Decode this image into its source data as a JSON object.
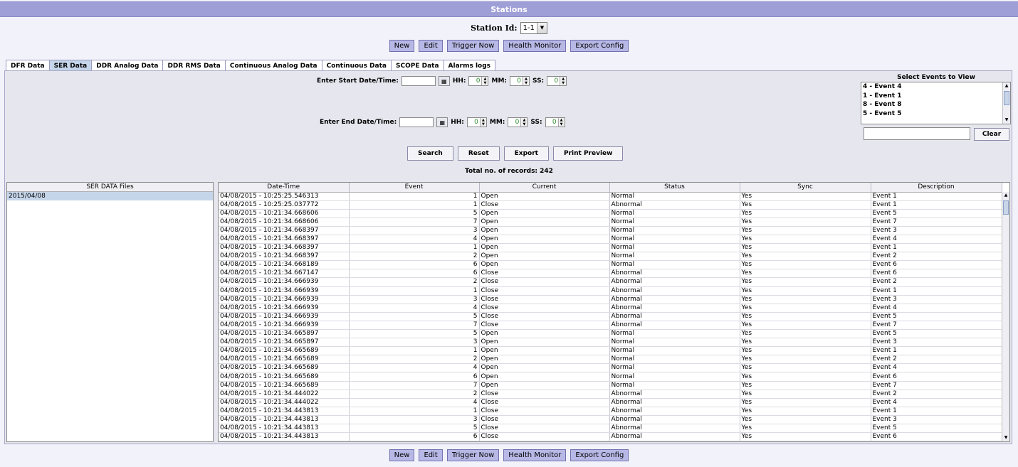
{
  "window": {
    "title": "Stations"
  },
  "station": {
    "label": "Station Id:",
    "value": "1-1"
  },
  "toolbar": {
    "buttons": [
      "New",
      "Edit",
      "Trigger Now",
      "Health Monitor",
      "Export Config"
    ]
  },
  "tabs": {
    "items": [
      "DFR Data",
      "SER Data",
      "DDR Analog Data",
      "DDR RMS Data",
      "Continuous Analog Data",
      "Continuous Data",
      "SCOPE Data",
      "Alarms logs"
    ],
    "active": "SER Data"
  },
  "filters": {
    "start_label": "Enter Start Date/Time:",
    "end_label": "Enter End Date/Time:",
    "hh_label": "HH:",
    "mm_label": "MM:",
    "ss_label": "SS:",
    "start": {
      "hh": "0",
      "mm": "0",
      "ss": "0"
    },
    "end": {
      "hh": "0",
      "mm": "0",
      "ss": "0"
    }
  },
  "actions": {
    "search": "Search",
    "reset": "Reset",
    "export": "Export",
    "print_preview": "Print Preview"
  },
  "total": "Total no. of records: 242",
  "events": {
    "title": "Select Events to View",
    "items": [
      "4 - Event 4",
      "1 - Event 1",
      "8 - Event 8",
      "5 - Event 5"
    ],
    "clear": "Clear"
  },
  "files": {
    "header": "SER DATA Files",
    "rows": [
      "2015/04/08"
    ]
  },
  "table": {
    "columns": [
      "Date-Time",
      "Event",
      "Current",
      "Status",
      "Sync",
      "Description"
    ],
    "rows": [
      [
        "04/08/2015 - 10:25:25.546313",
        "1",
        "Open",
        "Normal",
        "Yes",
        "Event 1"
      ],
      [
        "04/08/2015 - 10:25:25.037772",
        "1",
        "Close",
        "Abnormal",
        "Yes",
        "Event 1"
      ],
      [
        "04/08/2015 - 10:21:34.668606",
        "5",
        "Open",
        "Normal",
        "Yes",
        "Event 5"
      ],
      [
        "04/08/2015 - 10:21:34.668606",
        "7",
        "Open",
        "Normal",
        "Yes",
        "Event 7"
      ],
      [
        "04/08/2015 - 10:21:34.668397",
        "3",
        "Open",
        "Normal",
        "Yes",
        "Event 3"
      ],
      [
        "04/08/2015 - 10:21:34.668397",
        "4",
        "Open",
        "Normal",
        "Yes",
        "Event 4"
      ],
      [
        "04/08/2015 - 10:21:34.668397",
        "1",
        "Open",
        "Normal",
        "Yes",
        "Event 1"
      ],
      [
        "04/08/2015 - 10:21:34.668397",
        "2",
        "Open",
        "Normal",
        "Yes",
        "Event 2"
      ],
      [
        "04/08/2015 - 10:21:34.668189",
        "6",
        "Open",
        "Normal",
        "Yes",
        "Event 6"
      ],
      [
        "04/08/2015 - 10:21:34.667147",
        "6",
        "Close",
        "Abnormal",
        "Yes",
        "Event 6"
      ],
      [
        "04/08/2015 - 10:21:34.666939",
        "2",
        "Close",
        "Abnormal",
        "Yes",
        "Event 2"
      ],
      [
        "04/08/2015 - 10:21:34.666939",
        "1",
        "Close",
        "Abnormal",
        "Yes",
        "Event 1"
      ],
      [
        "04/08/2015 - 10:21:34.666939",
        "3",
        "Close",
        "Abnormal",
        "Yes",
        "Event 3"
      ],
      [
        "04/08/2015 - 10:21:34.666939",
        "4",
        "Close",
        "Abnormal",
        "Yes",
        "Event 4"
      ],
      [
        "04/08/2015 - 10:21:34.666939",
        "5",
        "Close",
        "Abnormal",
        "Yes",
        "Event 5"
      ],
      [
        "04/08/2015 - 10:21:34.666939",
        "7",
        "Close",
        "Abnormal",
        "Yes",
        "Event 7"
      ],
      [
        "04/08/2015 - 10:21:34.665897",
        "5",
        "Open",
        "Normal",
        "Yes",
        "Event 5"
      ],
      [
        "04/08/2015 - 10:21:34.665897",
        "3",
        "Open",
        "Normal",
        "Yes",
        "Event 3"
      ],
      [
        "04/08/2015 - 10:21:34.665689",
        "1",
        "Open",
        "Normal",
        "Yes",
        "Event 1"
      ],
      [
        "04/08/2015 - 10:21:34.665689",
        "2",
        "Open",
        "Normal",
        "Yes",
        "Event 2"
      ],
      [
        "04/08/2015 - 10:21:34.665689",
        "4",
        "Open",
        "Normal",
        "Yes",
        "Event 4"
      ],
      [
        "04/08/2015 - 10:21:34.665689",
        "6",
        "Open",
        "Normal",
        "Yes",
        "Event 6"
      ],
      [
        "04/08/2015 - 10:21:34.665689",
        "7",
        "Open",
        "Normal",
        "Yes",
        "Event 7"
      ],
      [
        "04/08/2015 - 10:21:34.444022",
        "2",
        "Close",
        "Abnormal",
        "Yes",
        "Event 2"
      ],
      [
        "04/08/2015 - 10:21:34.444022",
        "4",
        "Close",
        "Abnormal",
        "Yes",
        "Event 4"
      ],
      [
        "04/08/2015 - 10:21:34.443813",
        "1",
        "Close",
        "Abnormal",
        "Yes",
        "Event 1"
      ],
      [
        "04/08/2015 - 10:21:34.443813",
        "3",
        "Close",
        "Abnormal",
        "Yes",
        "Event 3"
      ],
      [
        "04/08/2015 - 10:21:34.443813",
        "5",
        "Close",
        "Abnormal",
        "Yes",
        "Event 5"
      ],
      [
        "04/08/2015 - 10:21:34.443813",
        "6",
        "Close",
        "Abnormal",
        "Yes",
        "Event 6"
      ]
    ]
  }
}
